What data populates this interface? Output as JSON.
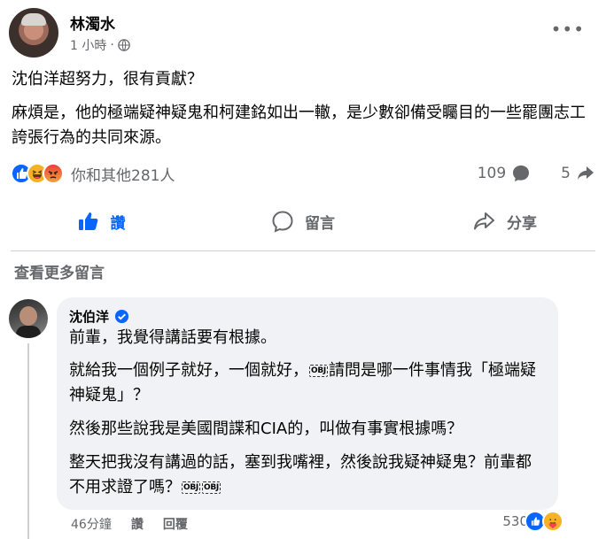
{
  "post": {
    "author": "林濁水",
    "time": "1 小時",
    "more_label": "•••",
    "paragraphs": [
      "沈伯洋超努力，很有貢獻？",
      "麻煩是，他的極端疑神疑鬼和柯建銘如出一轍，是少數卻備受矚目的一些罷團志工誇張行為的共同來源。"
    ],
    "reactions": {
      "icons": [
        "like-icon",
        "haha-icon",
        "angry-icon"
      ],
      "summary": "你和其他281人"
    },
    "comment_count": "109",
    "share_count": "5"
  },
  "actions": {
    "like": "讚",
    "comment": "留言",
    "share": "分享"
  },
  "view_more": "查看更多留言",
  "comment": {
    "author": "沈伯洋",
    "lines": {
      "p1": "前輩，我覺得講話要有根據。",
      "p2a": "就給我一個例子就好，一個就好，",
      "p2b": "請問是哪一件事情我「極端疑神疑鬼」？",
      "p3": "然後那些說我是美國間諜和CIA的，叫做有事實根據嗎？",
      "p4a": "整天把我沒有講過的話，塞到我嘴裡，然後說我疑神疑鬼？前輩都不用求證了嗎？"
    },
    "emoji_tag": "OBJ",
    "time": "46分鐘",
    "like_label": "讚",
    "reply_label": "回覆",
    "reaction_count": "530"
  },
  "colors": {
    "accent": "#0866ff",
    "secondary_text": "#65676b",
    "bubble": "#f0f2f5"
  }
}
